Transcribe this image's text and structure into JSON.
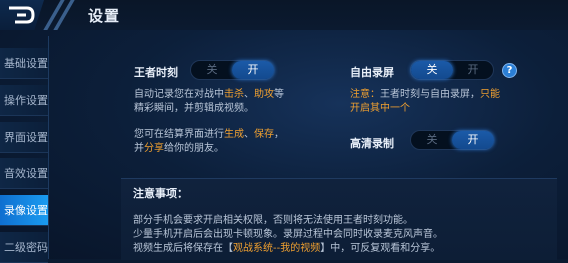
{
  "header": {
    "title": "设置",
    "back_icon": "back-arrow-icon"
  },
  "sidebar": {
    "items": [
      {
        "label": "基础设置",
        "active": false
      },
      {
        "label": "操作设置",
        "active": false
      },
      {
        "label": "界面设置",
        "active": false
      },
      {
        "label": "音效设置",
        "active": false
      },
      {
        "label": "录像设置",
        "active": true
      },
      {
        "label": "二级密码",
        "active": false
      }
    ]
  },
  "king_moment": {
    "label": "王者时刻",
    "toggle": {
      "off_label": "关",
      "on_label": "开",
      "value": "on"
    },
    "desc1": {
      "p1": "自动记录您在对战中",
      "h1": "击杀",
      "p2": "、",
      "h2": "助攻",
      "p3": "等",
      "line2": "精彩瞬间，并剪辑成视频。"
    },
    "desc2": {
      "p1": "您可在结算界面进行",
      "h1": "生成",
      "p2": "、",
      "h2": "保存",
      "p3": "，",
      "l2a": "并",
      "h3": "分享",
      "l2b": "给你的朋友。"
    }
  },
  "free_record": {
    "label": "自由录屏",
    "toggle": {
      "off_label": "关",
      "on_label": "开",
      "value": "off"
    },
    "help_icon": "question-icon",
    "help_text": "?",
    "note": {
      "p1": "注意：",
      "p2": "王者时刻与自由录屏，",
      "h1": "只能",
      "line2": "开启其中一个"
    }
  },
  "hd_record": {
    "label": "高清录制",
    "toggle": {
      "off_label": "关",
      "on_label": "开",
      "value": "on"
    }
  },
  "notice": {
    "title": "注意事项：",
    "line1": "部分手机会要求开启相关权限，否则将无法使用王者时刻功能。",
    "line2": "少量手机开启后会出现卡顿现象。录屏过程中会同时收录麦克风声音。",
    "line3a": "视频生成后将保存在【",
    "line3h": "观战系统--我的视频",
    "line3b": "】中，可反复观看和分享。"
  },
  "colors": {
    "accent": "#1a9bf0",
    "highlight": "#f0a030"
  }
}
